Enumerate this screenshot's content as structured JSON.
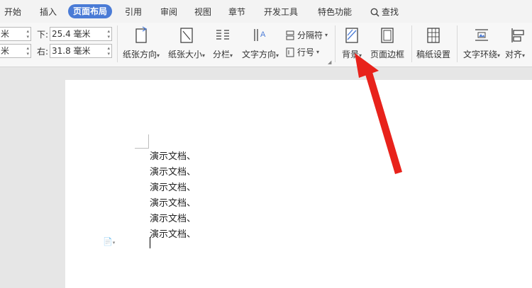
{
  "tabs": [
    {
      "label": "开始",
      "active": false
    },
    {
      "label": "插入",
      "active": false
    },
    {
      "label": "页面布局",
      "active": true
    },
    {
      "label": "引用",
      "active": false
    },
    {
      "label": "审阅",
      "active": false
    },
    {
      "label": "视图",
      "active": false
    },
    {
      "label": "章节",
      "active": false
    },
    {
      "label": "开发工具",
      "active": false
    },
    {
      "label": "特色功能",
      "active": false
    }
  ],
  "search_label": "查找",
  "margins": {
    "left_cut_top": "米",
    "left_cut_bottom": "米",
    "bottom_label": "下:",
    "bottom_value": "25.4 毫米",
    "right_label": "右:",
    "right_value": "31.8 毫米"
  },
  "ribbon": {
    "orientation": "纸张方向",
    "size": "纸张大小",
    "columns": "分栏",
    "text_direction": "文字方向",
    "separator": "分隔符",
    "line_number": "行号",
    "background": "背景",
    "page_border": "页面边框",
    "grid_paper": "稿纸设置",
    "text_wrap": "文字环绕",
    "align": "对齐"
  },
  "document": {
    "lines": [
      "演示文档、",
      "演示文档、",
      "演示文档、",
      "演示文档、",
      "演示文档、",
      "演示文档、"
    ]
  },
  "colors": {
    "accent": "#4a7bd6",
    "arrow": "#e8221b"
  }
}
